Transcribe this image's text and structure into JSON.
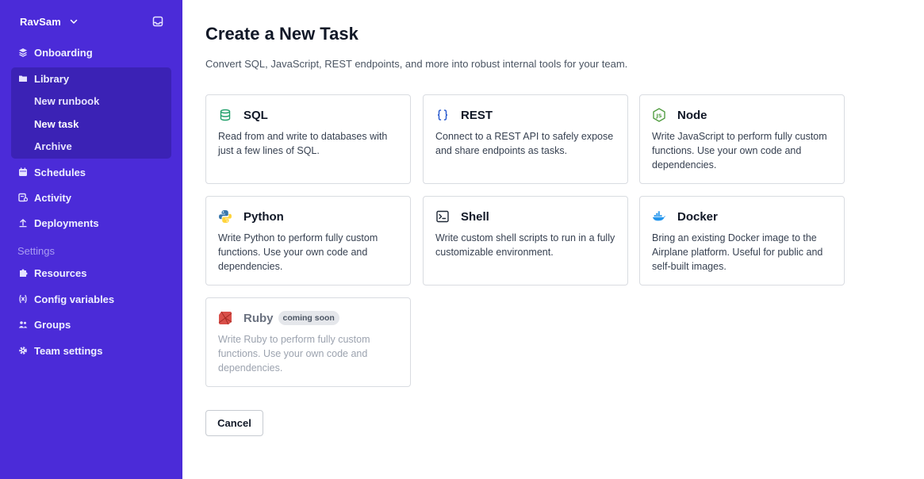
{
  "workspace": {
    "name": "RavSam"
  },
  "sidebar": {
    "items": [
      {
        "label": "Onboarding"
      },
      {
        "label": "Library"
      },
      {
        "label": "Schedules"
      },
      {
        "label": "Activity"
      },
      {
        "label": "Deployments"
      }
    ],
    "library_subitems": [
      {
        "label": "New runbook"
      },
      {
        "label": "New task",
        "active": true
      },
      {
        "label": "Archive"
      }
    ],
    "settings_label": "Settings",
    "settings_items": [
      {
        "label": "Resources"
      },
      {
        "label": "Config variables"
      },
      {
        "label": "Groups"
      },
      {
        "label": "Team settings"
      }
    ]
  },
  "main": {
    "title": "Create a New Task",
    "subtitle": "Convert SQL, JavaScript, REST endpoints, and more into robust internal tools for your team.",
    "cards": [
      {
        "title": "SQL",
        "icon": "database-icon",
        "description": "Read from and write to databases with just a few lines of SQL."
      },
      {
        "title": "REST",
        "icon": "braces-icon",
        "description": "Connect to a REST API to safely expose and share endpoints as tasks."
      },
      {
        "title": "Node",
        "icon": "nodejs-icon",
        "description": "Write JavaScript to perform fully custom functions. Use your own code and dependencies."
      },
      {
        "title": "Python",
        "icon": "python-icon",
        "description": "Write Python to perform fully custom functions. Use your own code and dependencies."
      },
      {
        "title": "Shell",
        "icon": "terminal-icon",
        "description": "Write custom shell scripts to run in a fully customizable environment."
      },
      {
        "title": "Docker",
        "icon": "docker-icon",
        "description": "Bring an existing Docker image to the Airplane platform. Useful for public and self-built images."
      },
      {
        "title": "Ruby",
        "icon": "ruby-icon",
        "badge": "coming soon",
        "description": "Write Ruby to perform fully custom functions. Use your own code and dependencies."
      }
    ],
    "cancel_label": "Cancel"
  },
  "colors": {
    "sidebar_bg": "#4b2bd8",
    "sidebar_active_group": "#3b22b5",
    "sql_icon": "#22a06b",
    "rest_icon": "#2f5fd0",
    "node_icon": "#539e43",
    "docker_icon": "#2496ed",
    "ruby_icon": "#c4392f"
  }
}
